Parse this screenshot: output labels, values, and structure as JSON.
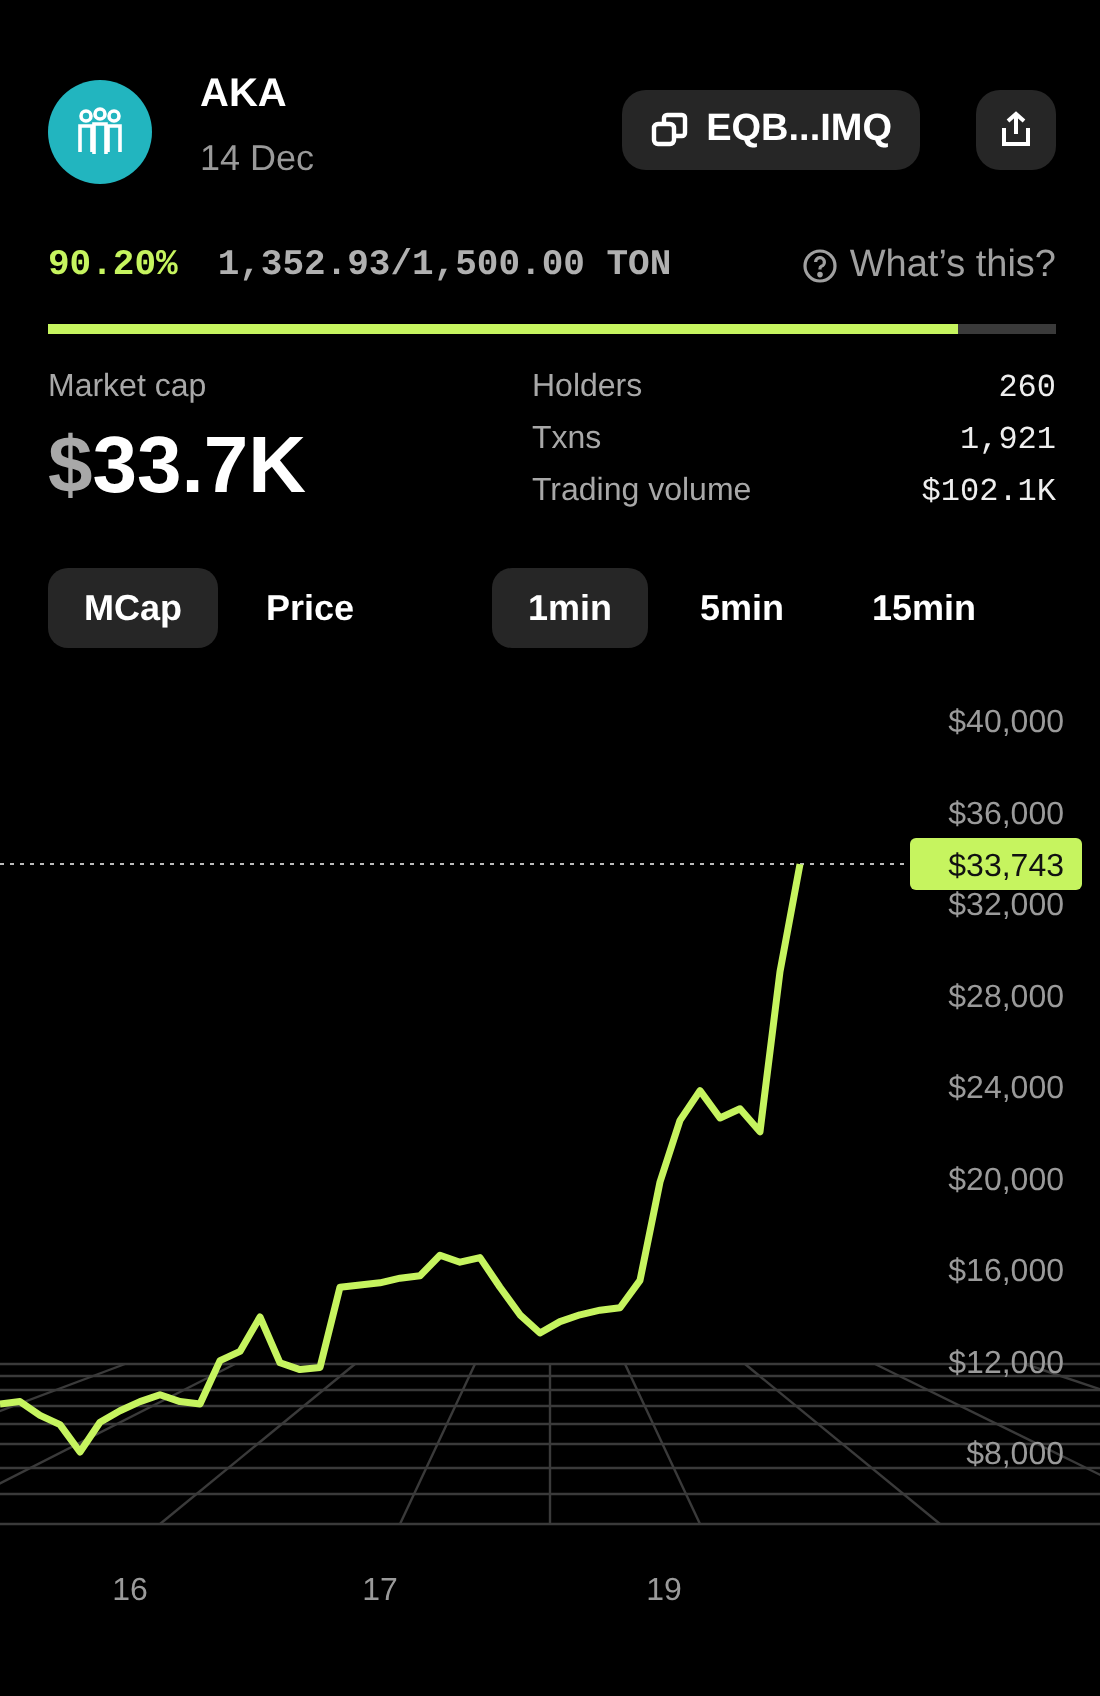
{
  "token": {
    "name": "AKA",
    "date": "14 Dec",
    "address": "EQB...IMQ"
  },
  "progress": {
    "percent": "90.20%",
    "amount": "1,352.93/1,500.00 TON",
    "help": "What’s this?",
    "level": 0.902
  },
  "market_cap": {
    "label": "Market cap",
    "currency": "$",
    "value": "33.7K"
  },
  "stats": [
    {
      "label": "Holders",
      "value": "260"
    },
    {
      "label": "Txns",
      "value": "1,921"
    },
    {
      "label": "Trading volume",
      "value": "$102.1K"
    }
  ],
  "chart_types": [
    {
      "label": "MCap",
      "selected": true
    },
    {
      "label": "Price",
      "selected": false
    }
  ],
  "intervals": [
    {
      "label": "1min",
      "selected": true
    },
    {
      "label": "5min",
      "selected": false
    },
    {
      "label": "15min",
      "selected": false
    }
  ],
  "chart": {
    "current": "$33,743",
    "x_labels": [
      "16",
      "17",
      "19"
    ],
    "chart_data": {
      "type": "line",
      "ylim": [
        8000,
        40000
      ],
      "ref_lines": [
        {
          "axis": "y",
          "value": 33700
        }
      ],
      "yticks": [
        {
          "value": 40000,
          "label": "$40,000"
        },
        {
          "value": 36000,
          "label": "$36,000"
        },
        {
          "value": 32000,
          "label": "$32,000"
        },
        {
          "value": 28000,
          "label": "$28,000"
        },
        {
          "value": 24000,
          "label": "$24,000"
        },
        {
          "value": 20000,
          "label": "$20,000"
        },
        {
          "value": 16000,
          "label": "$16,000"
        },
        {
          "value": 12000,
          "label": "$12,000"
        },
        {
          "value": 8000,
          "label": "$8,000"
        }
      ],
      "series": [
        {
          "color": "#c6f45f",
          "values": [
            10100,
            10200,
            9600,
            9200,
            8000,
            9300,
            9800,
            10200,
            10500,
            10200,
            10100,
            12000,
            12400,
            13900,
            11900,
            11600,
            11700,
            15200,
            15300,
            15400,
            15600,
            15700,
            16600,
            16300,
            16500,
            15200,
            14000,
            13200,
            13700,
            14000,
            14200,
            14300,
            15500,
            19800,
            22500,
            23800,
            22600,
            23000,
            22000,
            29000,
            33700
          ]
        }
      ]
    }
  }
}
